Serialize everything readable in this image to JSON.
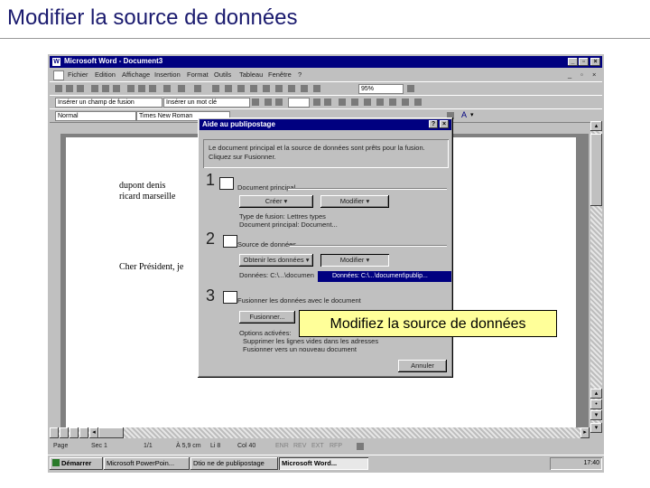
{
  "slide": {
    "title": "Modifier la source de données"
  },
  "word": {
    "window_title": "Microsoft Word - Document3",
    "menu": [
      "Fichier",
      "Edition",
      "Affichage",
      "Insertion",
      "Format",
      "Outils",
      "Tableau",
      "Fenêtre",
      "?"
    ],
    "zoom": "95%",
    "style_combo": "Normal",
    "font_combo": "Times New Roman",
    "merge_field_combo": "Insérer un champ de fusion",
    "word_field_combo": "Insérer un mot clé",
    "doc_text": {
      "line1": "dupont denis",
      "line2": "ricard marseille",
      "salutation": "Cher Président, je"
    },
    "status": {
      "page": "Page",
      "sec": "Sec 1",
      "pages": "1/1",
      "pos": "À 5,9 cm",
      "line": "Li 8",
      "col": "Col 40",
      "modes": [
        "ENR",
        "REV",
        "EXT",
        "RFP"
      ]
    },
    "taskbar": {
      "start": "Démarrer",
      "tasks": [
        "Microsoft PowerPoin...",
        "Dtio ne de publipostage",
        "Microsoft Word..."
      ],
      "clock": "17:40"
    }
  },
  "dialog": {
    "title": "Aide au publipostage",
    "intro_line1": "Le document principal et la source de données sont prêts pour la fusion.",
    "intro_line2": "Cliquez sur Fusionner.",
    "step1": {
      "num": "1",
      "label": "Document principal",
      "create": "Créer ▾",
      "modify": "Modifier ▾",
      "info1": "Type de fusion: Lettres types",
      "info2": "Document principal: Document..."
    },
    "step2": {
      "num": "2",
      "label": "Source de données",
      "get": "Obtenir les données ▾",
      "modify": "Modifier ▾",
      "info": "Données: C:\\...\\documen",
      "dropdown_item": "Données: C:\\...\\document\\publip..."
    },
    "step3": {
      "num": "3",
      "label": "Fusionner les données avec le document",
      "merge": "Fusionner...",
      "options_title": "Options activées:",
      "option1": "Supprimer les lignes vides dans les adresses",
      "option2": "Fusionner vers un nouveau document"
    },
    "cancel": "Annuler"
  },
  "callout": {
    "text": "Modifiez la source de données"
  }
}
